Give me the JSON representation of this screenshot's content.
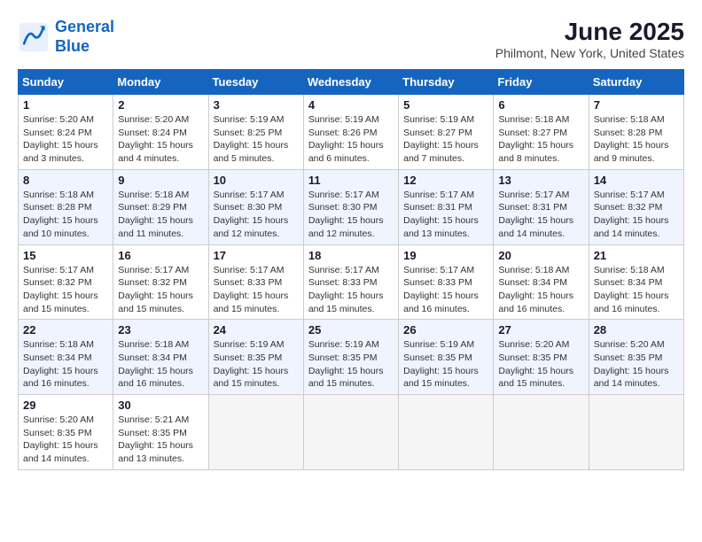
{
  "header": {
    "logo_line1": "General",
    "logo_line2": "Blue",
    "month": "June 2025",
    "location": "Philmont, New York, United States"
  },
  "weekdays": [
    "Sunday",
    "Monday",
    "Tuesday",
    "Wednesday",
    "Thursday",
    "Friday",
    "Saturday"
  ],
  "weeks": [
    [
      {
        "day": "1",
        "info": "Sunrise: 5:20 AM\nSunset: 8:24 PM\nDaylight: 15 hours\nand 3 minutes."
      },
      {
        "day": "2",
        "info": "Sunrise: 5:20 AM\nSunset: 8:24 PM\nDaylight: 15 hours\nand 4 minutes."
      },
      {
        "day": "3",
        "info": "Sunrise: 5:19 AM\nSunset: 8:25 PM\nDaylight: 15 hours\nand 5 minutes."
      },
      {
        "day": "4",
        "info": "Sunrise: 5:19 AM\nSunset: 8:26 PM\nDaylight: 15 hours\nand 6 minutes."
      },
      {
        "day": "5",
        "info": "Sunrise: 5:19 AM\nSunset: 8:27 PM\nDaylight: 15 hours\nand 7 minutes."
      },
      {
        "day": "6",
        "info": "Sunrise: 5:18 AM\nSunset: 8:27 PM\nDaylight: 15 hours\nand 8 minutes."
      },
      {
        "day": "7",
        "info": "Sunrise: 5:18 AM\nSunset: 8:28 PM\nDaylight: 15 hours\nand 9 minutes."
      }
    ],
    [
      {
        "day": "8",
        "info": "Sunrise: 5:18 AM\nSunset: 8:28 PM\nDaylight: 15 hours\nand 10 minutes."
      },
      {
        "day": "9",
        "info": "Sunrise: 5:18 AM\nSunset: 8:29 PM\nDaylight: 15 hours\nand 11 minutes."
      },
      {
        "day": "10",
        "info": "Sunrise: 5:17 AM\nSunset: 8:30 PM\nDaylight: 15 hours\nand 12 minutes."
      },
      {
        "day": "11",
        "info": "Sunrise: 5:17 AM\nSunset: 8:30 PM\nDaylight: 15 hours\nand 12 minutes."
      },
      {
        "day": "12",
        "info": "Sunrise: 5:17 AM\nSunset: 8:31 PM\nDaylight: 15 hours\nand 13 minutes."
      },
      {
        "day": "13",
        "info": "Sunrise: 5:17 AM\nSunset: 8:31 PM\nDaylight: 15 hours\nand 14 minutes."
      },
      {
        "day": "14",
        "info": "Sunrise: 5:17 AM\nSunset: 8:32 PM\nDaylight: 15 hours\nand 14 minutes."
      }
    ],
    [
      {
        "day": "15",
        "info": "Sunrise: 5:17 AM\nSunset: 8:32 PM\nDaylight: 15 hours\nand 15 minutes."
      },
      {
        "day": "16",
        "info": "Sunrise: 5:17 AM\nSunset: 8:32 PM\nDaylight: 15 hours\nand 15 minutes."
      },
      {
        "day": "17",
        "info": "Sunrise: 5:17 AM\nSunset: 8:33 PM\nDaylight: 15 hours\nand 15 minutes."
      },
      {
        "day": "18",
        "info": "Sunrise: 5:17 AM\nSunset: 8:33 PM\nDaylight: 15 hours\nand 15 minutes."
      },
      {
        "day": "19",
        "info": "Sunrise: 5:17 AM\nSunset: 8:33 PM\nDaylight: 15 hours\nand 16 minutes."
      },
      {
        "day": "20",
        "info": "Sunrise: 5:18 AM\nSunset: 8:34 PM\nDaylight: 15 hours\nand 16 minutes."
      },
      {
        "day": "21",
        "info": "Sunrise: 5:18 AM\nSunset: 8:34 PM\nDaylight: 15 hours\nand 16 minutes."
      }
    ],
    [
      {
        "day": "22",
        "info": "Sunrise: 5:18 AM\nSunset: 8:34 PM\nDaylight: 15 hours\nand 16 minutes."
      },
      {
        "day": "23",
        "info": "Sunrise: 5:18 AM\nSunset: 8:34 PM\nDaylight: 15 hours\nand 16 minutes."
      },
      {
        "day": "24",
        "info": "Sunrise: 5:19 AM\nSunset: 8:35 PM\nDaylight: 15 hours\nand 15 minutes."
      },
      {
        "day": "25",
        "info": "Sunrise: 5:19 AM\nSunset: 8:35 PM\nDaylight: 15 hours\nand 15 minutes."
      },
      {
        "day": "26",
        "info": "Sunrise: 5:19 AM\nSunset: 8:35 PM\nDaylight: 15 hours\nand 15 minutes."
      },
      {
        "day": "27",
        "info": "Sunrise: 5:20 AM\nSunset: 8:35 PM\nDaylight: 15 hours\nand 15 minutes."
      },
      {
        "day": "28",
        "info": "Sunrise: 5:20 AM\nSunset: 8:35 PM\nDaylight: 15 hours\nand 14 minutes."
      }
    ],
    [
      {
        "day": "29",
        "info": "Sunrise: 5:20 AM\nSunset: 8:35 PM\nDaylight: 15 hours\nand 14 minutes."
      },
      {
        "day": "30",
        "info": "Sunrise: 5:21 AM\nSunset: 8:35 PM\nDaylight: 15 hours\nand 13 minutes."
      },
      null,
      null,
      null,
      null,
      null
    ]
  ]
}
